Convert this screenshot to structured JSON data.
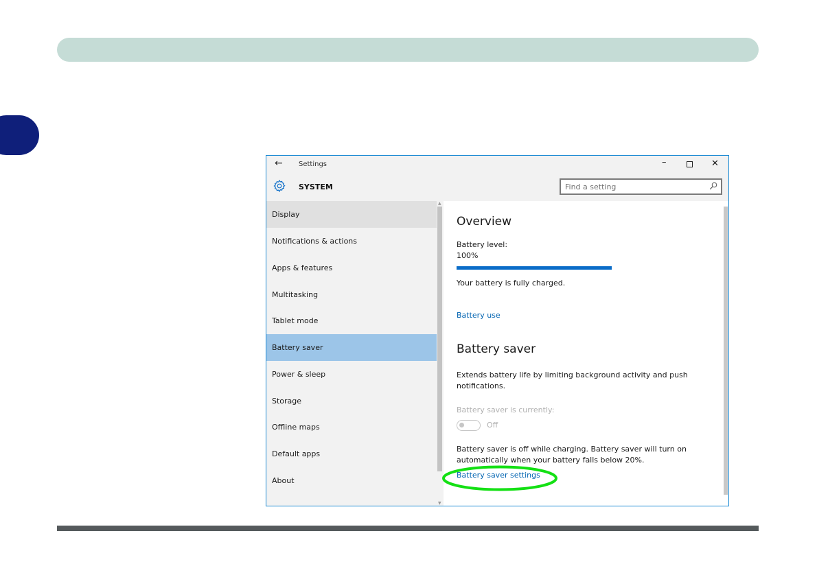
{
  "colors": {
    "top_bar": "#c5dcd6",
    "side_tab": "#0f1f7a",
    "accent": "#0a6cc8",
    "link": "#0063b1",
    "selected_nav": "#9cc5e8",
    "highlight": "#14e014"
  },
  "window": {
    "title": "Settings",
    "back_icon": "back-arrow-icon",
    "controls": {
      "minimize": "minimize-icon",
      "maximize": "maximize-icon",
      "close": "close-icon"
    }
  },
  "header": {
    "icon": "gear-icon",
    "title": "SYSTEM",
    "search_placeholder": "Find a setting",
    "search_icon": "search-icon"
  },
  "nav": {
    "items": [
      {
        "label": "Display",
        "state": "hover"
      },
      {
        "label": "Notifications & actions",
        "state": ""
      },
      {
        "label": "Apps & features",
        "state": ""
      },
      {
        "label": "Multitasking",
        "state": ""
      },
      {
        "label": "Tablet mode",
        "state": ""
      },
      {
        "label": "Battery saver",
        "state": "selected"
      },
      {
        "label": "Power & sleep",
        "state": ""
      },
      {
        "label": "Storage",
        "state": ""
      },
      {
        "label": "Offline maps",
        "state": ""
      },
      {
        "label": "Default apps",
        "state": ""
      },
      {
        "label": "About",
        "state": ""
      }
    ]
  },
  "content": {
    "overview_heading": "Overview",
    "battery_level_label": "Battery level:",
    "battery_level_value": "100%",
    "battery_level_fraction": 1.0,
    "charged_text": "Your battery is fully charged.",
    "battery_use_link": "Battery use",
    "saver_heading": "Battery saver",
    "saver_description_line1": "Extends battery life by limiting background activity and push",
    "saver_description_line2": "notifications.",
    "saver_currently_label": "Battery saver is currently:",
    "toggle_state": "Off",
    "charging_note_line1": "Battery saver is off while charging. Battery saver will turn on",
    "charging_note_line2": "automatically when your battery falls below 20%.",
    "settings_link": "Battery saver settings"
  }
}
